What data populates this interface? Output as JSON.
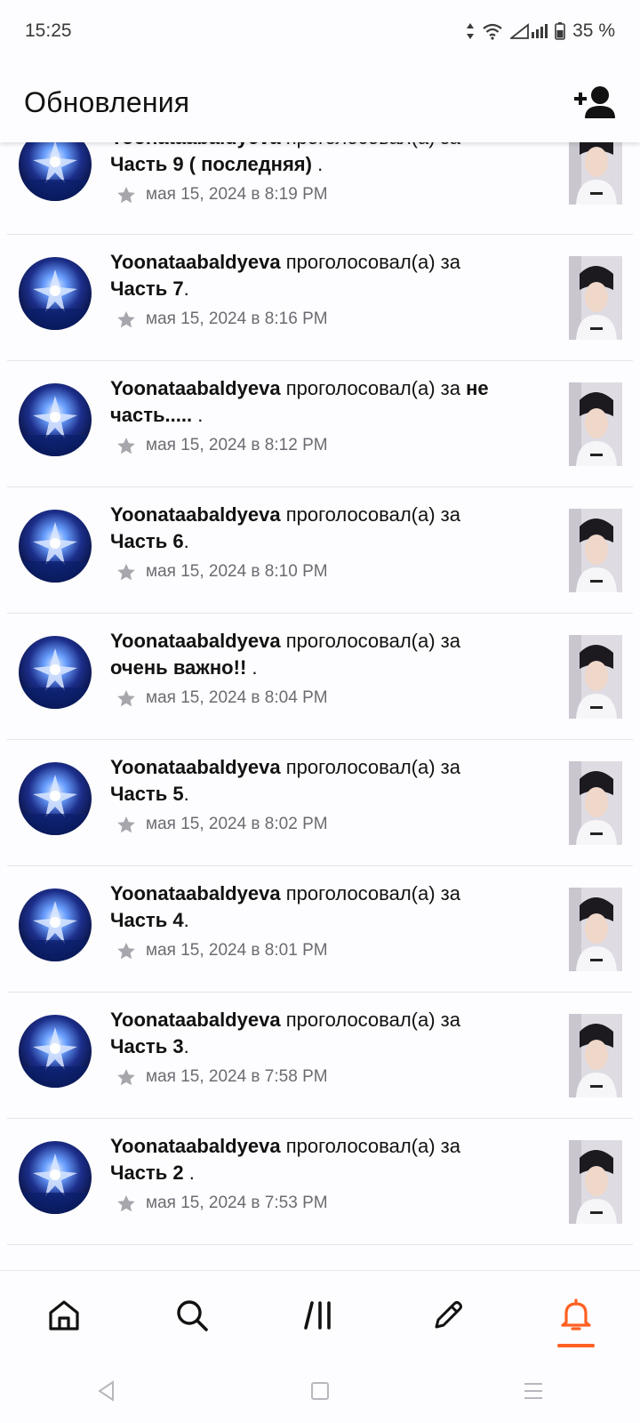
{
  "status_bar": {
    "time": "15:25",
    "battery": "35 %"
  },
  "header": {
    "title": "Обновления"
  },
  "colors": {
    "accent": "#ff6122",
    "text": "#121212",
    "meta": "#6d6b72"
  },
  "feed": {
    "items": [
      {
        "user": "Yoonataabaldyeva",
        "action": "проголосовал(а) за",
        "story_line1": "Часть 9 ( последняя)",
        "story_line2": "",
        "suffix": ".",
        "date": "мая 15, 2024 в 8:19 PM"
      },
      {
        "user": "Yoonataabaldyeva",
        "action": "проголосовал(а) за",
        "story_line1": "Часть 7",
        "story_line2": "",
        "suffix": ".",
        "date": "мая 15, 2024 в 8:16 PM"
      },
      {
        "user": "Yoonataabaldyeva",
        "action": "проголосовал(а) за",
        "story_line1": "не",
        "story_line2": "часть.....",
        "suffix": ".",
        "date": "мая 15, 2024 в 8:12 PM"
      },
      {
        "user": "Yoonataabaldyeva",
        "action": "проголосовал(а) за",
        "story_line1": "Часть 6",
        "story_line2": "",
        "suffix": ".",
        "date": "мая 15, 2024 в 8:10 PM"
      },
      {
        "user": "Yoonataabaldyeva",
        "action": "проголосовал(а) за",
        "story_line1": "очень важно!!",
        "story_line2": "",
        "suffix": ".",
        "date": "мая 15, 2024 в 8:04 PM"
      },
      {
        "user": "Yoonataabaldyeva",
        "action": "проголосовал(а) за",
        "story_line1": "Часть 5",
        "story_line2": "",
        "suffix": ".",
        "date": "мая 15, 2024 в 8:02 PM"
      },
      {
        "user": "Yoonataabaldyeva",
        "action": "проголосовал(а) за",
        "story_line1": "Часть 4",
        "story_line2": "",
        "suffix": ".",
        "date": "мая 15, 2024 в 8:01 PM"
      },
      {
        "user": "Yoonataabaldyeva",
        "action": "проголосовал(а) за",
        "story_line1": "Часть 3",
        "story_line2": "",
        "suffix": ".",
        "date": "мая 15, 2024 в 7:58 PM"
      },
      {
        "user": "Yoonataabaldyeva",
        "action": "проголосовал(а) за",
        "story_line1": "Часть 2",
        "story_line2": "",
        "suffix": ".",
        "date": "мая 15, 2024 в 7:53 PM"
      }
    ]
  },
  "bottom_nav": {
    "items": [
      {
        "icon": "home-icon",
        "active": false
      },
      {
        "icon": "search-icon",
        "active": false
      },
      {
        "icon": "library-icon",
        "active": false
      },
      {
        "icon": "write-icon",
        "active": false
      },
      {
        "icon": "notifications-icon",
        "active": true
      }
    ]
  }
}
